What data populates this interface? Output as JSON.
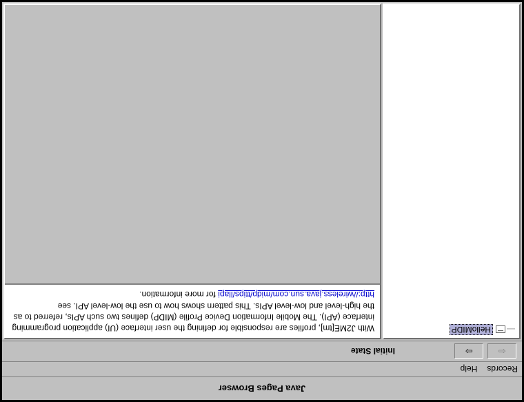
{
  "window": {
    "title": "Java Pages Browser"
  },
  "menu": {
    "records": "Records",
    "help": "Help"
  },
  "toolbar": {
    "back_glyph": "⇦",
    "forward_glyph": "⇨",
    "status": "Initial State"
  },
  "tree": {
    "item0": {
      "label": "HelloMIDP",
      "selected": true
    }
  },
  "description": {
    "text_before_link": "With J2ME[tm], profiles are responsible for defining the user interface (UI) application programming interface (API). The Mobile Information Device Profile (MIDP) defines two such APIs, referred to as the high-level and low-level APIs. This pattern shows how to use the low-level API. see ",
    "link_text": "http://wireless.java.sun.com/midp/ttips/llapi",
    "text_after_link": " for more information."
  }
}
